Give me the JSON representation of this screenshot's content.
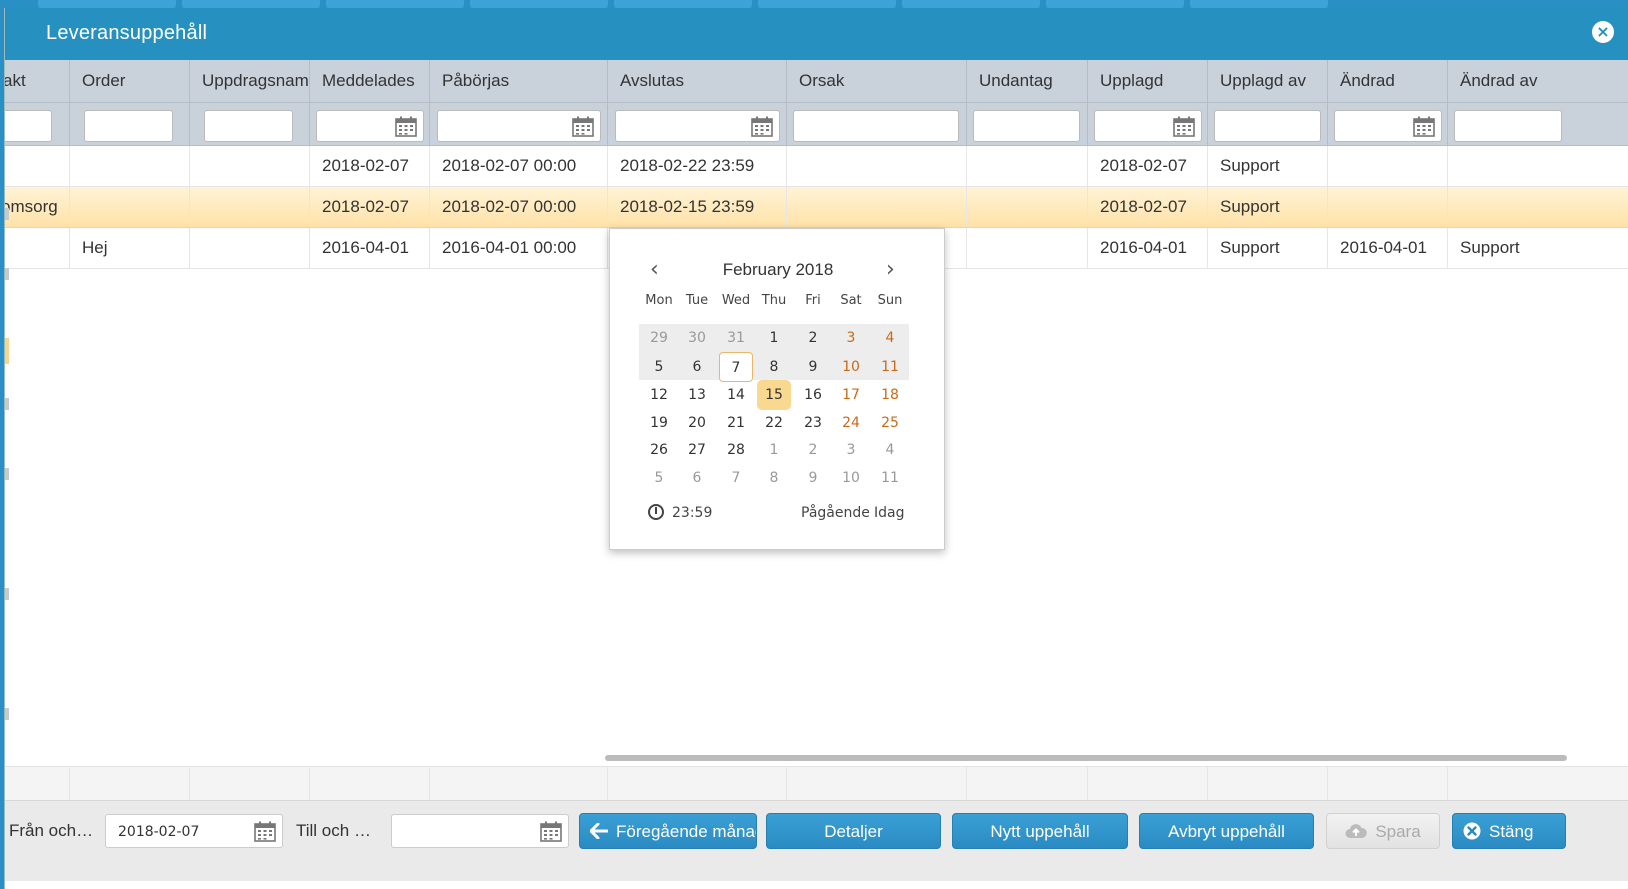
{
  "dialog": {
    "title": "Leveransuppehåll"
  },
  "columns": [
    {
      "key": "kontakt",
      "label": "akt"
    },
    {
      "key": "order",
      "label": "Order"
    },
    {
      "key": "uppdragsnamn",
      "label": "Uppdragsnam"
    },
    {
      "key": "meddelades",
      "label": "Meddelades"
    },
    {
      "key": "paborjas",
      "label": "Påbörjas"
    },
    {
      "key": "avslutas",
      "label": "Avslutas"
    },
    {
      "key": "orsak",
      "label": "Orsak"
    },
    {
      "key": "undantag",
      "label": "Undantag"
    },
    {
      "key": "upplagd",
      "label": "Upplagd"
    },
    {
      "key": "upplagd_av",
      "label": "Upplagd av"
    },
    {
      "key": "andrad",
      "label": "Ändrad"
    },
    {
      "key": "andrad_av",
      "label": "Ändrad av"
    }
  ],
  "rows": [
    {
      "kontakt": "",
      "order": "",
      "uppdragsnamn": "",
      "meddelades": "2018-02-07",
      "paborjas": "2018-02-07 00:00",
      "avslutas": "2018-02-22 23:59",
      "orsak": "",
      "undantag": "",
      "upplagd": "2018-02-07",
      "upplagd_av": "Support",
      "andrad": "",
      "andrad_av": ""
    },
    {
      "kontakt": "omsorg",
      "order": "",
      "uppdragsnamn": "",
      "meddelades": "2018-02-07",
      "paborjas": "2018-02-07 00:00",
      "avslutas": "2018-02-15 23:59",
      "orsak": "",
      "undantag": "",
      "upplagd": "2018-02-07",
      "upplagd_av": "Support",
      "andrad": "",
      "andrad_av": ""
    },
    {
      "kontakt": "",
      "order": "Hej",
      "uppdragsnamn": "",
      "meddelades": "2016-04-01",
      "paborjas": "2016-04-01 00:00",
      "avslutas": "",
      "orsak": "",
      "undantag": "",
      "upplagd": "2016-04-01",
      "upplagd_av": "Support",
      "andrad": "2016-04-01",
      "andrad_av": "Support"
    }
  ],
  "datepicker": {
    "month_label": "February 2018",
    "prev_icon": "chevron-left-icon",
    "next_icon": "chevron-right-icon",
    "weekdays": [
      "Mon",
      "Tue",
      "Wed",
      "Thu",
      "Fri",
      "Sat",
      "Sun"
    ],
    "weeks": [
      [
        "29",
        "30",
        "31",
        "1",
        "2",
        "3",
        "4"
      ],
      [
        "5",
        "6",
        "7",
        "8",
        "9",
        "10",
        "11"
      ],
      [
        "12",
        "13",
        "14",
        "15",
        "16",
        "17",
        "18"
      ],
      [
        "19",
        "20",
        "21",
        "22",
        "23",
        "24",
        "25"
      ],
      [
        "26",
        "27",
        "28",
        "1",
        "2",
        "3",
        "4"
      ],
      [
        "5",
        "6",
        "7",
        "8",
        "9",
        "10",
        "11"
      ]
    ],
    "time": "23:59",
    "link_ongoing": "Pågående",
    "link_today": "Idag",
    "weekend_color": "#c86a1a",
    "selected_color": "#f9d890"
  },
  "footer": {
    "from_label": "Från och…",
    "from_value": "2018-02-07",
    "to_label": "Till och …",
    "to_value": "",
    "btn_prev_month": "Föregående månad",
    "btn_details": "Detaljer",
    "btn_new": "Nytt uppehåll",
    "btn_cancel": "Avbryt uppehåll",
    "btn_save": "Spara",
    "btn_close": "Stäng"
  },
  "colors": {
    "accent": "#2690c1",
    "header_bg": "#c9d1db",
    "row_selected": "#ffe2a8"
  }
}
